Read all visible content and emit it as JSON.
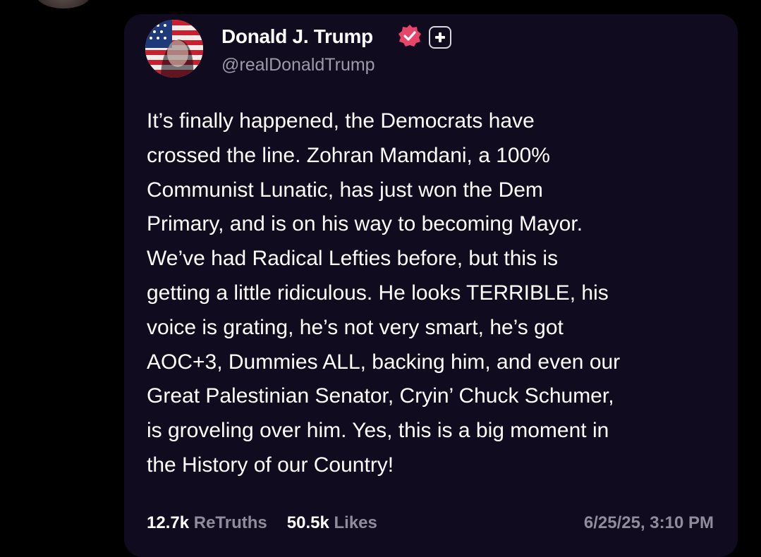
{
  "post": {
    "author_name": "Donald J. Trump",
    "handle": "@realDonaldTrump",
    "lines": [
      "It’s finally happened, the Democrats have",
      "crossed the line. Zohran Mamdani, a 100%",
      "Communist Lunatic, has just won the Dem",
      "Primary, and is on his way to becoming Mayor.",
      "We’ve had Radical Lefties before, but this is",
      "getting a little ridiculous. He looks TERRIBLE, his",
      "voice is grating, he’s not very smart, he’s got",
      "AOC+3, Dummies ALL, backing him, and even our",
      "Great Palestinian Senator, Cryin’ Chuck Schumer,",
      "is groveling over him. Yes, this is a big moment in",
      "the History of our Country!"
    ],
    "retruths_count": "12.7k",
    "retruths_label": "ReTruths",
    "likes_count": "50.5k",
    "likes_label": "Likes",
    "timestamp": "6/25/25, 3:10 PM"
  },
  "icons": {
    "verified": "verified-badge-icon",
    "plus": "plus-badge-icon"
  },
  "colors": {
    "background": "#000000",
    "card": "#100b1f",
    "verified_badge": "#e8456b",
    "secondary_text": "#8f8c9c"
  }
}
